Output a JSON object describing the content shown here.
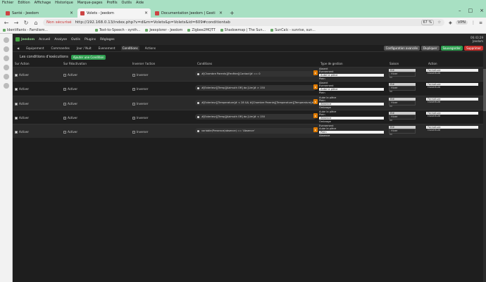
{
  "menubar": [
    "Fichier",
    "Edition",
    "Affichage",
    "Historique",
    "Marque-pages",
    "Profils",
    "Outils",
    "Aide"
  ],
  "tabs": [
    {
      "label": "Santé - Jeedom",
      "active": false
    },
    {
      "label": "Volets - Jeedom",
      "active": true
    },
    {
      "label": "Documentation Jeedom | Gesti",
      "active": false
    }
  ],
  "nav": {
    "security": "Non sécurisé",
    "url": "http://192.168.0.13/index.php?v=d&m=Volets&p=Volets&id=609#conditiontab",
    "zoom": "67 %",
    "vpn": "VPN"
  },
  "bookmarks": [
    "Identifiants - Familiem...",
    "Text-to-Speech - synth...",
    "Jeexplorer - Jeedom",
    "Zigbee2MQTT",
    "Shadowmap | The Sun...",
    "SunCalc - sunrise, sun..."
  ],
  "jeedom": {
    "logo": "Jeedom",
    "menus": [
      "Accueil",
      "Analyse",
      "Outils",
      "Plugins",
      "Réglages"
    ],
    "clock_time": "06:43:29",
    "clock_site": "Jeedom"
  },
  "pagetabs": [
    "Equipement",
    "Commandes",
    "Jour / Nuit",
    "Evenement",
    "Conditions",
    "Actions"
  ],
  "pagebuttons": {
    "config": "Configuration avancée",
    "dup": "Dupliquer",
    "save": "Sauvegarder",
    "del": "Supprimer"
  },
  "section": {
    "title": "Les conditions d'exécutions",
    "add": "Ajouter une Condition"
  },
  "headers": {
    "sur_action": "Sur Action",
    "sur_react": "Sur Réactivation",
    "inverser": "Inverser l'action",
    "conditions": "Conditions",
    "type": "Type de gestion",
    "saison": "Saison",
    "action": "Action"
  },
  "rows": [
    {
      "sur_action": "Activer",
      "sur_react": "Activer",
      "inverser": "Inverser",
      "condition": "#[Chambre Parents][Fenêtre][Contact]# == 0",
      "ordre": [
        "Absent",
        "Evenement",
        "Aube la pièce",
        "Plein"
      ],
      "saison": [
        "Eté",
        "Hiver"
      ],
      "action": [
        "Fermeture",
        "Ouverture"
      ]
    },
    {
      "sur_action": "Activer",
      "sur_react": "Activer",
      "inverser": "Inverser",
      "condition": "#[Exterieur][Temp][Azimuth OR] da [Lim]# > 150",
      "ordre": [
        "Absent",
        "Evenement",
        "Aube la pièce",
        "Plein"
      ],
      "saison": [
        "Eté",
        "Hiver"
      ],
      "action": [
        "Fermeture",
        "Ouverture"
      ]
    },
    {
      "sur_action": "Activer",
      "sur_react": "Activer",
      "inverser": "Inverser",
      "condition": "#[Exterieur][Temperature]# < 28 && #[Chambre Parents][Temperature][Temperature]# > 21",
      "ordre": [
        "Aube la pièce",
        "Plein",
        "Absence",
        "Ombrage"
      ],
      "saison": [
        "Eté",
        "Hiver"
      ],
      "action": [
        "Fermeture",
        "Ouverture"
      ]
    },
    {
      "sur_action": "Activer",
      "sur_react": "Activer",
      "inverser": "Inverser",
      "condition": "#[Exterieur][Temp][Azimuth OR] da [Lim]# < 150",
      "ordre": [
        "Aube la pièce",
        "Plein",
        "Absence",
        "Ombrage"
      ],
      "saison": [
        "Eté",
        "Hiver"
      ],
      "action": [
        "Fermeture",
        "Ouverture"
      ]
    },
    {
      "sur_action": "Activer",
      "sur_react": "Activer",
      "inverser": "Inverser",
      "condition": "variable(Presence(absence) == 'Absence'",
      "ordre": [
        "Evenement",
        "Aube la pièce",
        "Plein",
        "Absence"
      ],
      "saison": [
        "Eté",
        "Hiver"
      ],
      "action": [
        "Fermeture",
        "Ouverture"
      ]
    }
  ]
}
